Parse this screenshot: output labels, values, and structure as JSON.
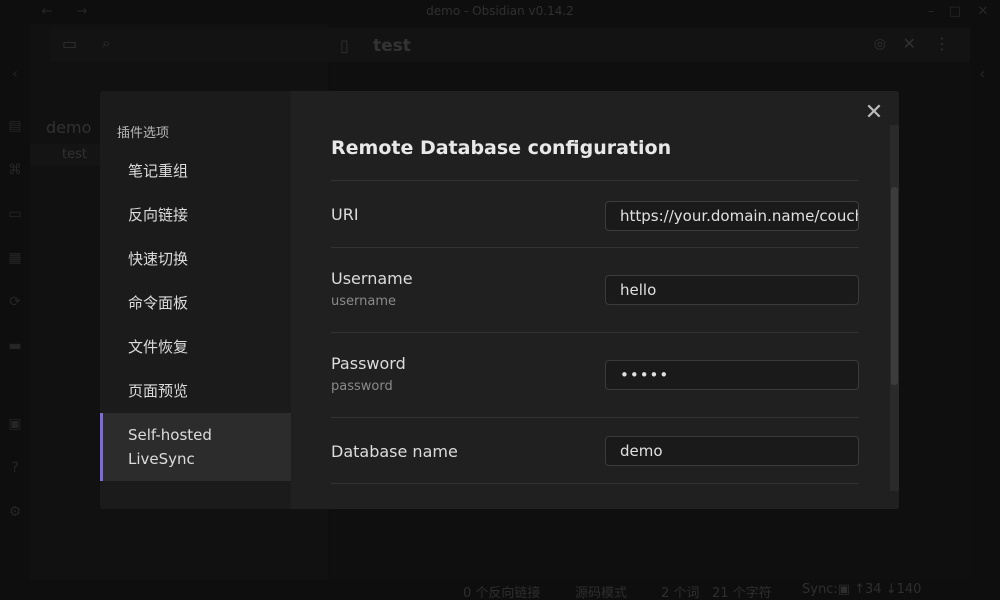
{
  "window": {
    "title": "demo - Obsidian v0.14.2"
  },
  "explorer": {
    "folder": "demo",
    "file": "test"
  },
  "editor": {
    "tab_title": "test"
  },
  "status_bar": {
    "backlinks": "0 个反向链接",
    "mode": "源码模式",
    "words": "2 个词",
    "chars": "21 个字符",
    "sync": "Sync:▣ ↑34 ↓140"
  },
  "settings": {
    "group_title": "插件选项",
    "nav_items": [
      {
        "label": "笔记重组"
      },
      {
        "label": "反向链接"
      },
      {
        "label": "快速切换"
      },
      {
        "label": "命令面板"
      },
      {
        "label": "文件恢复"
      },
      {
        "label": "页面预览"
      },
      {
        "label": "Self-hosted LiveSync",
        "line1": "Self-hosted",
        "line2": "LiveSync",
        "active": true
      }
    ],
    "section_title": "Remote Database configuration",
    "fields": {
      "uri": {
        "name": "URI",
        "value": "https://your.domain.name/couchdb"
      },
      "username": {
        "name": "Username",
        "desc": "username",
        "value": "hello"
      },
      "password": {
        "name": "Password",
        "desc": "password",
        "value": "•••••"
      },
      "dbname": {
        "name": "Database name",
        "value": "demo"
      }
    }
  },
  "icons": {
    "close": "close-icon",
    "folder": "folder-icon",
    "search": "search-icon"
  },
  "colors": {
    "accent": "#7b6cd9",
    "modal_bg": "#202020",
    "nav_bg": "#1b1b1b"
  }
}
